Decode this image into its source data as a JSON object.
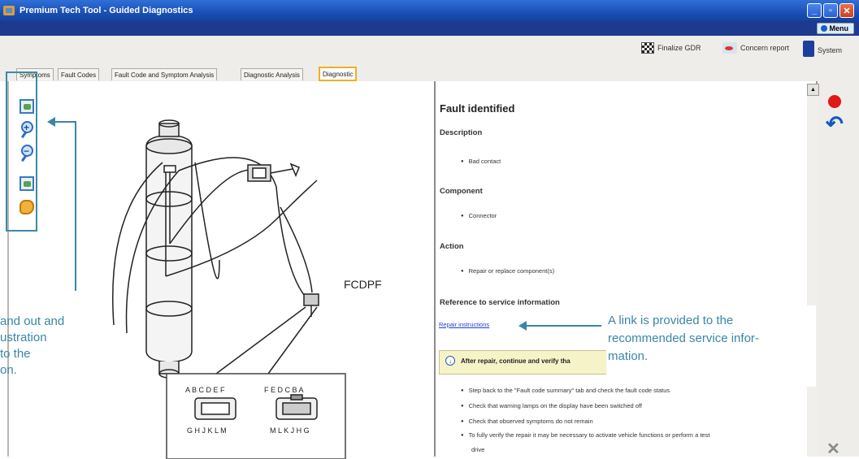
{
  "window": {
    "title": "Premium Tech Tool - Guided Diagnostics"
  },
  "menu": {
    "label": "Menu"
  },
  "toolbar": {
    "finalize_label": "Finalize GDR",
    "concern_label": "Concern report",
    "system_label": "System"
  },
  "tabs": [
    {
      "label": "Symptoms"
    },
    {
      "label": "Fault Codes"
    },
    {
      "label": "Fault Code and Symptom Analysis"
    },
    {
      "label": "Diagnostic Analysis"
    },
    {
      "label": "Diagnostic"
    }
  ],
  "diagram": {
    "component_label": "FCDPF",
    "connector_left_top": "A B C   D E F",
    "connector_left_bottom": "G H J K L M",
    "connector_right_top": "F E D    C B A",
    "connector_right_bottom": "M L K J H G"
  },
  "callout_left": {
    "lines": [
      "and out  and",
      "ustration",
      "to the",
      "on."
    ]
  },
  "report": {
    "title": "Fault identified",
    "description_heading": "Description",
    "description_item": "Bad contact",
    "component_heading": "Component",
    "component_item": "Connector",
    "action_heading": "Action",
    "action_item": "Repair or replace component(s)",
    "reference_heading": "Reference to service information",
    "repair_link": "Repair instructions",
    "note_text": "After repair, continue and verify tha",
    "steps": [
      "Step back to the \"Fault code summary\" tab and check the fault code status",
      "Check that warning lamps on the display have been switched off",
      "Check that observed symptoms do not remain",
      "To fully verify the repair it may be necessary to activate vehicle functions or perform a test",
      "drive"
    ]
  },
  "callout_right": {
    "lines": [
      "A link is provided to the",
      "recommended service infor-",
      "mation."
    ]
  },
  "colors": {
    "accent": "#3a86a8",
    "tab_highlight": "#f0b020",
    "title_bar": "#1a4fb6"
  }
}
